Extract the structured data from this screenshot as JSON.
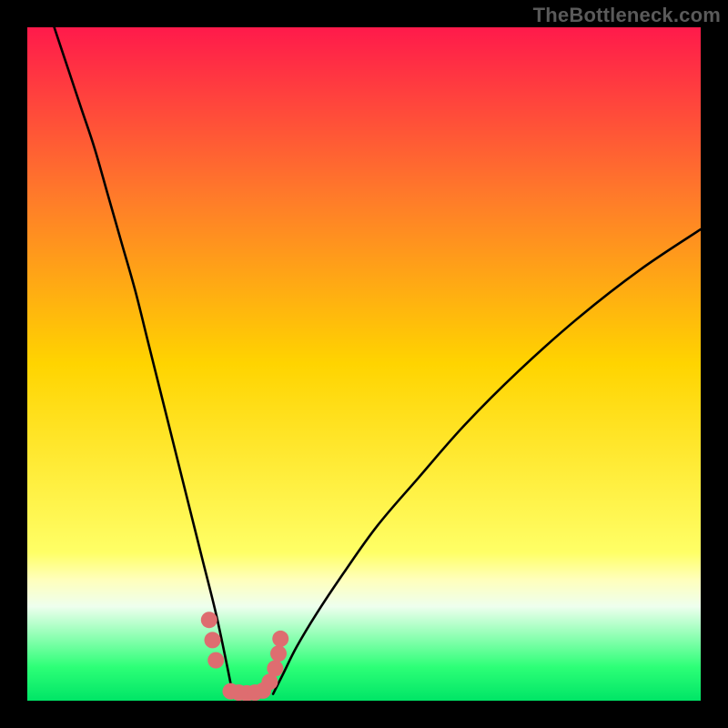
{
  "attribution": "TheBottleneck.com",
  "chart_data": {
    "type": "line",
    "title": "",
    "xlabel": "",
    "ylabel": "",
    "xlim": [
      0,
      100
    ],
    "ylim": [
      0,
      100
    ],
    "gradient_stops": [
      {
        "pos": 0.0,
        "color": "#ff1a4b"
      },
      {
        "pos": 0.25,
        "color": "#ff7a2a"
      },
      {
        "pos": 0.5,
        "color": "#ffd400"
      },
      {
        "pos": 0.78,
        "color": "#ffff66"
      },
      {
        "pos": 0.82,
        "color": "#ffffbb"
      },
      {
        "pos": 0.86,
        "color": "#eeffee"
      },
      {
        "pos": 0.95,
        "color": "#2dff77"
      },
      {
        "pos": 1.0,
        "color": "#00e566"
      }
    ],
    "series": [
      {
        "name": "left-branch",
        "x": [
          4,
          6,
          8,
          10,
          12,
          14,
          16,
          18,
          20,
          22,
          24,
          26,
          28,
          29.5,
          30.5
        ],
        "y": [
          100,
          94,
          88,
          82,
          75,
          68,
          61,
          53,
          45,
          37,
          29,
          21,
          13,
          6,
          1
        ]
      },
      {
        "name": "right-branch",
        "x": [
          36.5,
          38,
          40,
          43,
          47,
          52,
          58,
          65,
          73,
          82,
          91,
          100
        ],
        "y": [
          1,
          4,
          8,
          13,
          19,
          26,
          33,
          41,
          49,
          57,
          64,
          70
        ]
      },
      {
        "name": "bottom-dots",
        "type": "scatter",
        "color": "#de6d70",
        "x": [
          27.0,
          27.5,
          28.0,
          30.2,
          31.4,
          32.6,
          33.8,
          35.0,
          36.0,
          36.8,
          37.3,
          37.6
        ],
        "y": [
          12.0,
          9.0,
          6.0,
          1.4,
          1.2,
          1.1,
          1.2,
          1.5,
          2.8,
          4.8,
          7.0,
          9.2
        ]
      }
    ]
  }
}
